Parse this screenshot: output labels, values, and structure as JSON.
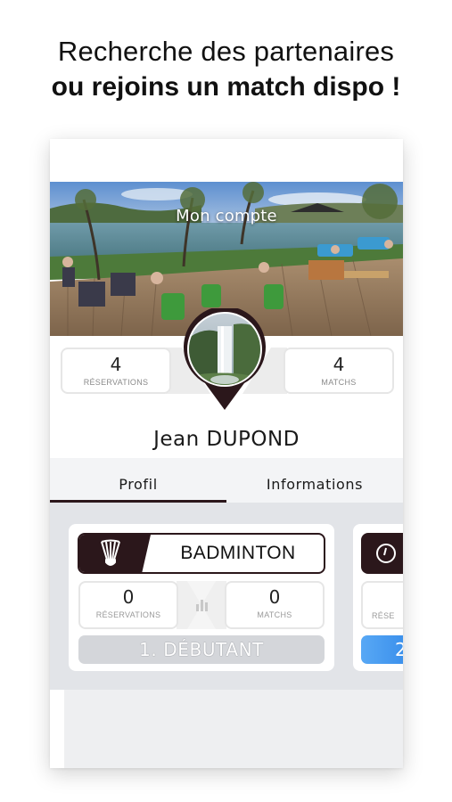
{
  "headline": {
    "line1": "Recherche des partenaires",
    "line2": "ou rejoins un match dispo !"
  },
  "profile": {
    "cover_title": "Mon compte",
    "reservations_count": "4",
    "reservations_label": "RÉSERVATIONS",
    "matchs_count": "4",
    "matchs_label": "MATCHS",
    "user_name": "Jean  DUPOND"
  },
  "tabs": [
    {
      "label": "Profil",
      "active": true
    },
    {
      "label": "Informations",
      "active": false
    }
  ],
  "sport_cards": [
    {
      "sport": "BADMINTON",
      "icon": "shuttlecock-icon",
      "reservations_count": "0",
      "reservations_label": "RÉSERVATIONS",
      "matchs_count": "0",
      "matchs_label": "MATCHS",
      "level": "1. DÉBUTANT",
      "level_color": "#d4d6da"
    },
    {
      "icon": "racket-icon",
      "reservations_label_partial": "RÉSE",
      "level_partial": "2",
      "level_color": "#3b8fe9"
    }
  ],
  "colors": {
    "accent_dark": "#2b171b",
    "tab_background": "#f3f4f6",
    "cards_background": "#e2e4e8"
  }
}
